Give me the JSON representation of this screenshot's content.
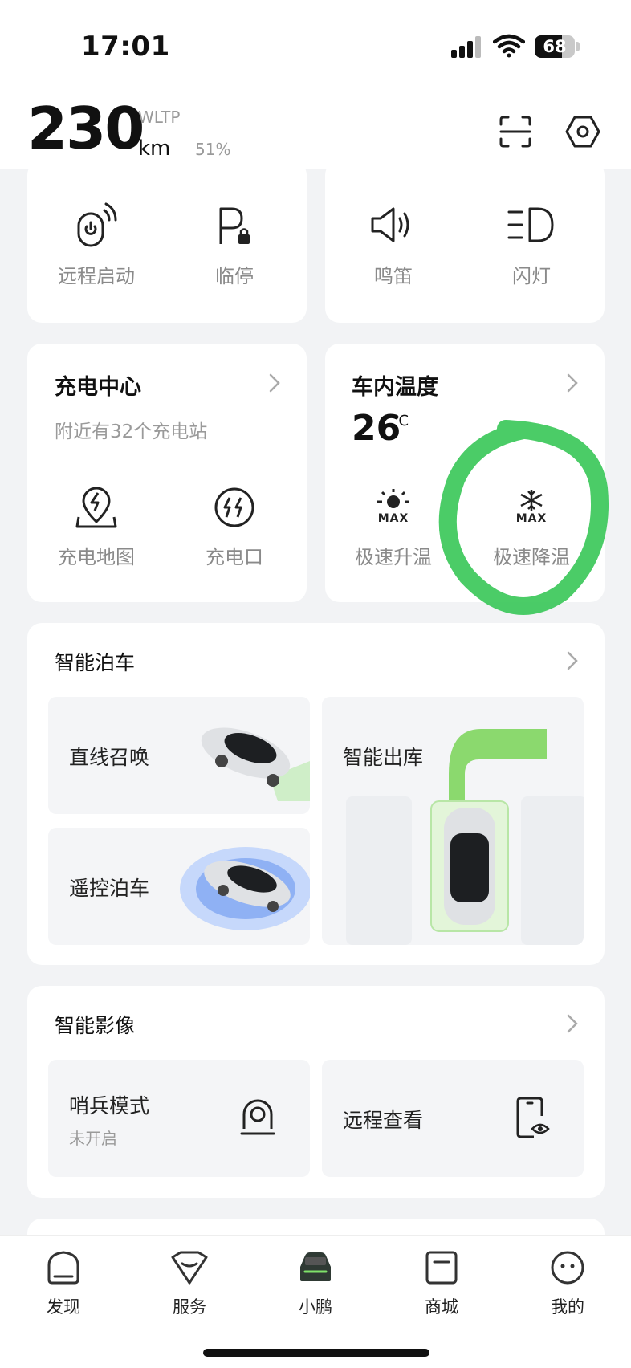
{
  "status_bar": {
    "time": "17:01",
    "battery": "68"
  },
  "header": {
    "range_value": "230",
    "range_unit": "km",
    "test_standard": "WLTP",
    "battery_percent": "51%"
  },
  "quick_actions": {
    "remote_start": "远程启动",
    "parking": "临停",
    "horn": "鸣笛",
    "flash": "闪灯"
  },
  "charging": {
    "title": "充电中心",
    "subtitle": "附近有32个充电站",
    "map": "充电地图",
    "port": "充电口"
  },
  "climate": {
    "title": "车内温度",
    "temp_value": "26",
    "temp_unit": "℃",
    "heat": "极速升温",
    "cool": "极速降温",
    "max_tag": "MAX"
  },
  "parking_section": {
    "title": "智能泊车",
    "summon": "直线召唤",
    "exit": "智能出库",
    "remote_park": "遥控泊车"
  },
  "imaging": {
    "title": "智能影像",
    "sentry": "哨兵模式",
    "sentry_status": "未开启",
    "remote_view": "远程查看"
  },
  "nav": [
    "发现",
    "服务",
    "小鹏",
    "商城",
    "我的"
  ],
  "colors": {
    "accent_green": "#3cc85a",
    "nav_active": "#2f3a34"
  }
}
